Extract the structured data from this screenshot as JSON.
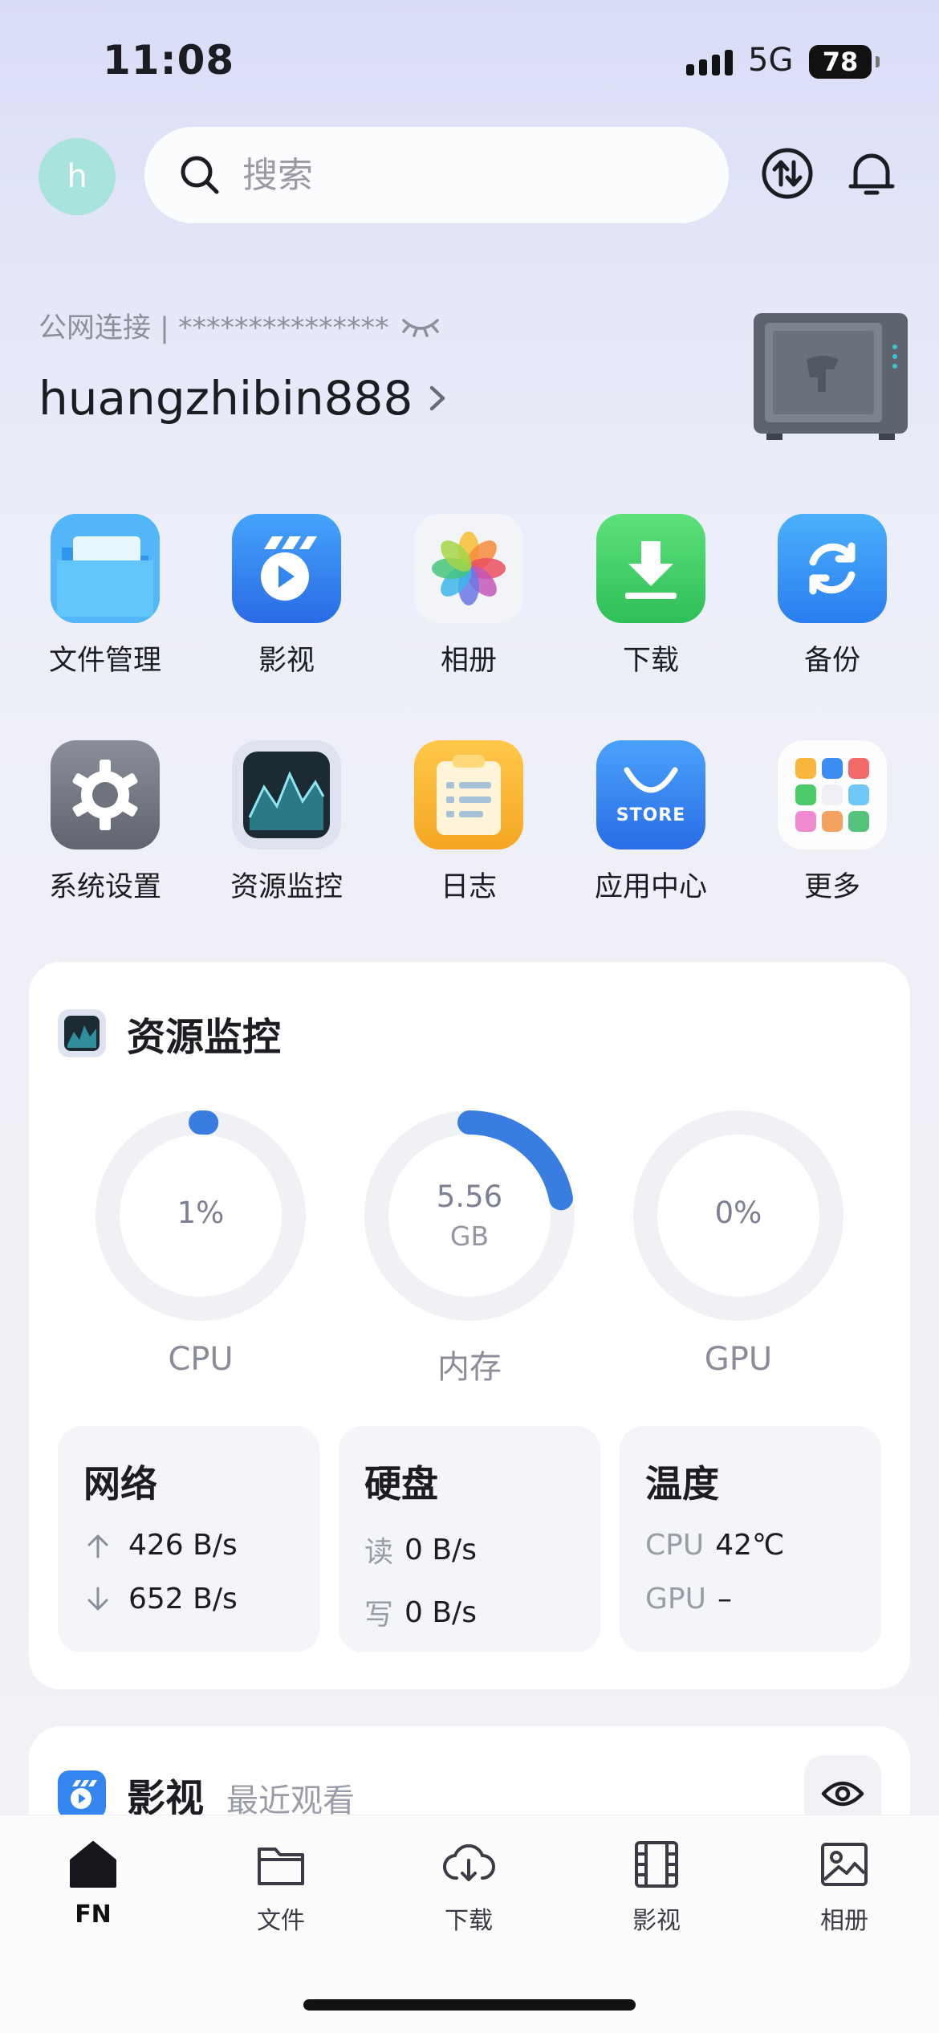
{
  "status_bar": {
    "time": "11:08",
    "network": "5G",
    "battery": "78"
  },
  "header": {
    "avatar_letter": "h",
    "search_placeholder": "搜索",
    "icons": [
      "transfer-icon",
      "bell-icon"
    ]
  },
  "connection": {
    "label": "公网连接 | ***************",
    "device_name": "huangzhibin888"
  },
  "apps_row1": [
    {
      "label": "文件管理",
      "icon": "folder-icon"
    },
    {
      "label": "影视",
      "icon": "video-app-icon"
    },
    {
      "label": "相册",
      "icon": "photos-icon"
    },
    {
      "label": "下载",
      "icon": "download-icon"
    },
    {
      "label": "备份",
      "icon": "backup-icon"
    }
  ],
  "apps_row2": [
    {
      "label": "系统设置",
      "icon": "gear-icon"
    },
    {
      "label": "资源监控",
      "icon": "monitor-icon"
    },
    {
      "label": "日志",
      "icon": "log-icon"
    },
    {
      "label": "应用中心",
      "icon": "store-icon",
      "badge": "STORE"
    },
    {
      "label": "更多",
      "icon": "more-grid-icon"
    }
  ],
  "resource": {
    "title": "资源监控",
    "gauges": [
      {
        "label": "CPU",
        "value": "1%",
        "unit": "",
        "fraction": 0.01
      },
      {
        "label": "内存",
        "value": "5.56",
        "unit": "GB",
        "fraction": 0.22
      },
      {
        "label": "GPU",
        "value": "0%",
        "unit": "",
        "fraction": 0
      }
    ],
    "network": {
      "title": "网络",
      "up": "426 B/s",
      "down": "652 B/s"
    },
    "disk": {
      "title": "硬盘",
      "read_key": "读",
      "read": "0 B/s",
      "write_key": "写",
      "write": "0 B/s"
    },
    "temp": {
      "title": "温度",
      "cpu_key": "CPU",
      "cpu": "42℃",
      "gpu_key": "GPU",
      "gpu": "–"
    }
  },
  "media": {
    "title": "影视",
    "subtitle": "最近观看"
  },
  "tabbar": [
    {
      "label": "FN",
      "icon": "home-icon",
      "active": true
    },
    {
      "label": "文件",
      "icon": "folder-icon"
    },
    {
      "label": "下载",
      "icon": "cloud-download-icon"
    },
    {
      "label": "影视",
      "icon": "film-icon"
    },
    {
      "label": "相册",
      "icon": "image-icon"
    }
  ],
  "colors": {
    "accent": "#3a7de0",
    "gauge_track": "#f0f1f5"
  }
}
